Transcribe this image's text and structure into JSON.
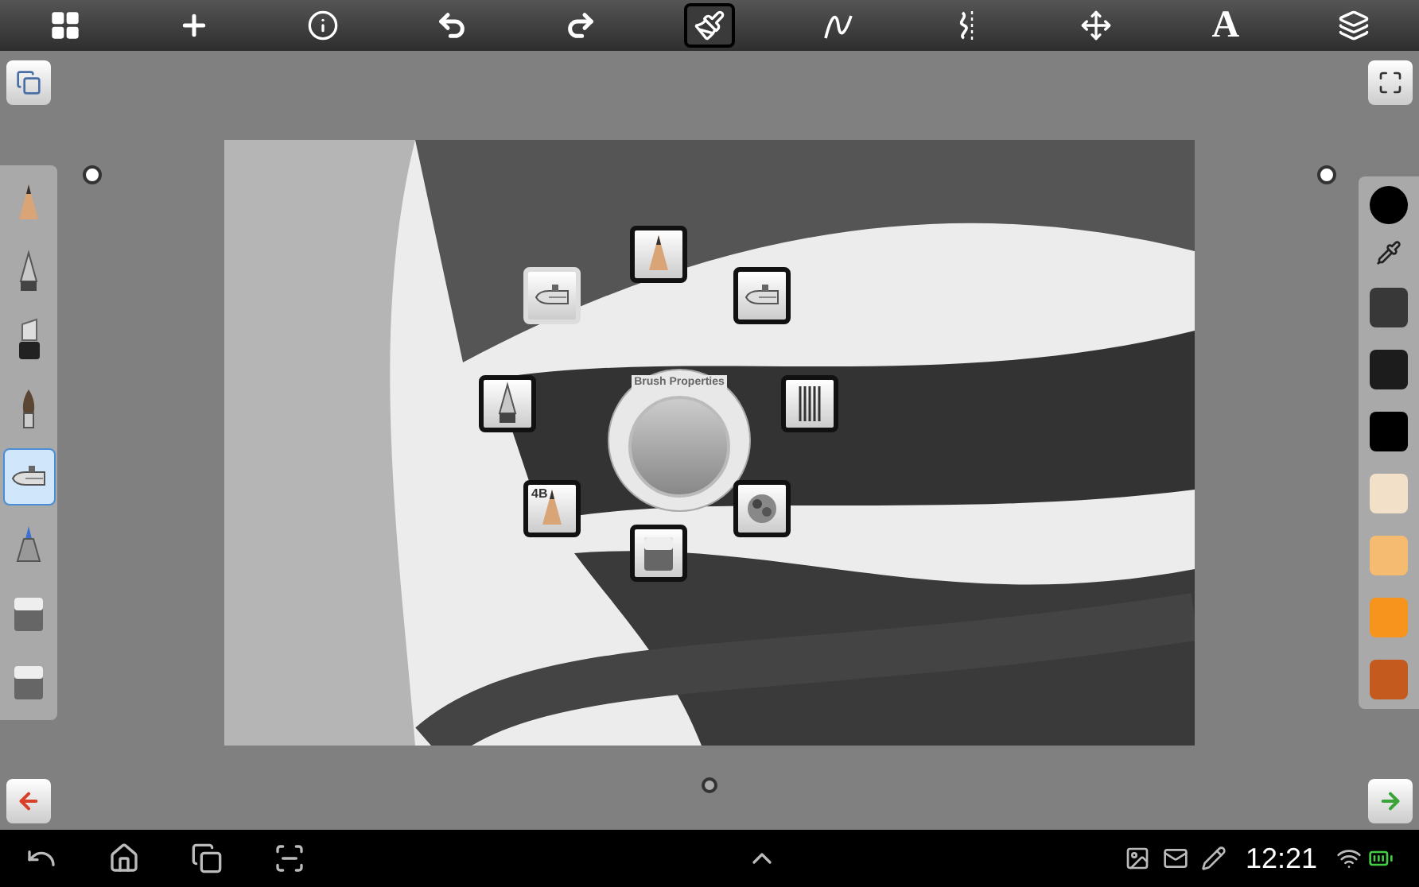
{
  "toolbar": [
    {
      "kind": "gallery",
      "selected": false
    },
    {
      "kind": "new",
      "selected": false
    },
    {
      "kind": "info",
      "selected": false
    },
    {
      "kind": "undo",
      "selected": false
    },
    {
      "kind": "redo",
      "selected": false
    },
    {
      "kind": "brush",
      "selected": true
    },
    {
      "kind": "curve",
      "selected": false
    },
    {
      "kind": "symmetry",
      "selected": false
    },
    {
      "kind": "move",
      "selected": false
    },
    {
      "kind": "text",
      "label": "A",
      "selected": false
    },
    {
      "kind": "layers",
      "selected": false
    }
  ],
  "brushes": [
    {
      "kind": "pencil",
      "selected": false
    },
    {
      "kind": "pen",
      "selected": false
    },
    {
      "kind": "marker",
      "selected": false
    },
    {
      "kind": "paintbrush",
      "selected": false
    },
    {
      "kind": "airbrush",
      "selected": true
    },
    {
      "kind": "felttip",
      "selected": false
    },
    {
      "kind": "eraser",
      "selected": false
    },
    {
      "kind": "eraser",
      "selected": false
    }
  ],
  "brush_ring": {
    "title": "Brush Properties",
    "items": [
      {
        "kind": "pencil",
        "selected": false
      },
      {
        "kind": "airbrush",
        "selected": true
      },
      {
        "kind": "airbrush",
        "selected": false
      },
      {
        "kind": "pen",
        "selected": false
      },
      {
        "kind": "hatch",
        "selected": false
      },
      {
        "kind": "pencil",
        "label": "4B",
        "selected": false
      },
      {
        "kind": "texture",
        "selected": false
      },
      {
        "kind": "eraser",
        "selected": false
      }
    ]
  },
  "palette": {
    "current": {
      "color": "#000000"
    },
    "swatches": [
      {
        "color": "#383838"
      },
      {
        "color": "#1c1c1c"
      },
      {
        "color": "#000000"
      },
      {
        "color": "#f2e0c8"
      },
      {
        "color": "#f5bb70"
      },
      {
        "color": "#f7941d"
      },
      {
        "color": "#c55a1f"
      }
    ]
  },
  "status_bar": {
    "time": "12:21"
  }
}
